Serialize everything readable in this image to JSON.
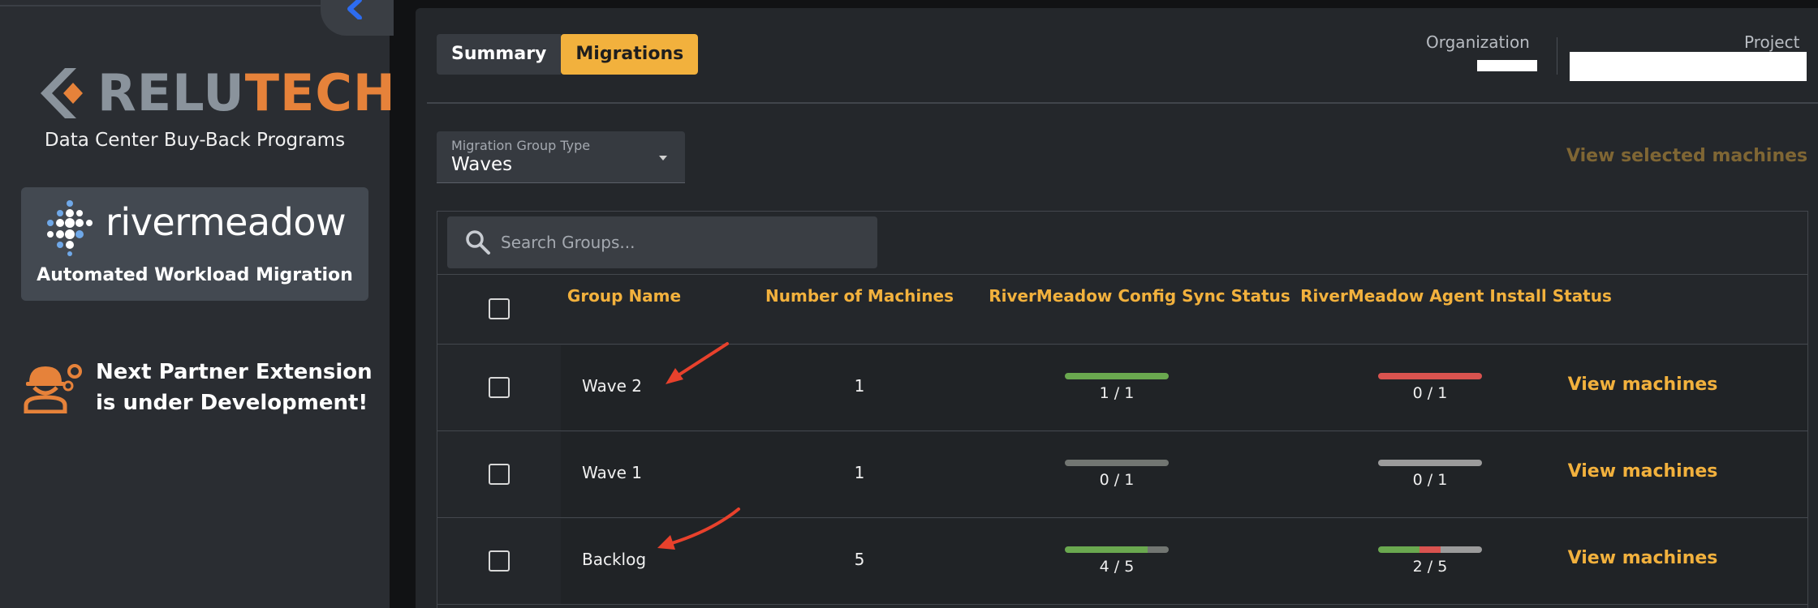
{
  "sidebar": {
    "brand_part1": "RELU",
    "brand_part2": "TECH",
    "tagline": "Data Center Buy-Back Programs",
    "partner_name": "rivermeadow",
    "partner_subtitle": "Automated Workload Migration",
    "dev_notice": "Next Partner Extension is under Development!"
  },
  "tabs": [
    {
      "label": "Summary",
      "active": false
    },
    {
      "label": "Migrations",
      "active": true
    }
  ],
  "header": {
    "organization_label": "Organization",
    "project_label": "Project"
  },
  "group_type_select": {
    "label": "Migration Group Type",
    "value": "Waves"
  },
  "view_selected_label": "View selected machines",
  "search": {
    "placeholder": "Search Groups..."
  },
  "table": {
    "columns": {
      "group_name": "Group Name",
      "machines": "Number of Machines",
      "config_sync": "RiverMeadow Config Sync Status",
      "agent_install": "RiverMeadow Agent Install Status"
    },
    "rows": [
      {
        "name": "Wave 2",
        "machines": "1",
        "sync_label": "1 / 1",
        "sync_fill": {
          "success": 1.0,
          "failed": 0.0,
          "pending": 0.0
        },
        "agent_label": "0 / 1",
        "agent_fill": {
          "success": 0.0,
          "failed": 1.0,
          "pending": 0.0
        },
        "action": "View machines"
      },
      {
        "name": "Wave 1",
        "machines": "1",
        "sync_label": "0 / 1",
        "sync_fill": {
          "success": 0.0,
          "failed": 0.0,
          "pending": 1.0
        },
        "agent_label": "0 / 1",
        "agent_fill": {
          "success": 0.0,
          "failed": 0.0,
          "pending": 1.0
        },
        "action": "View machines"
      },
      {
        "name": "Backlog",
        "machines": "5",
        "sync_label": "4 / 5",
        "sync_fill": {
          "success": 0.8,
          "failed": 0.0,
          "pending": 0.2
        },
        "agent_label": "2 / 5",
        "agent_fill": {
          "success": 0.4,
          "failed": 0.2,
          "pending": 0.4
        },
        "action": "View machines"
      }
    ]
  },
  "colors": {
    "accent": "#f2b13d",
    "success": "#6aa84f",
    "failed": "#d9534f",
    "pending_sync": "#727672",
    "pending_agent": "#9b9b9b",
    "annotation_arrow": "#e8412c"
  }
}
